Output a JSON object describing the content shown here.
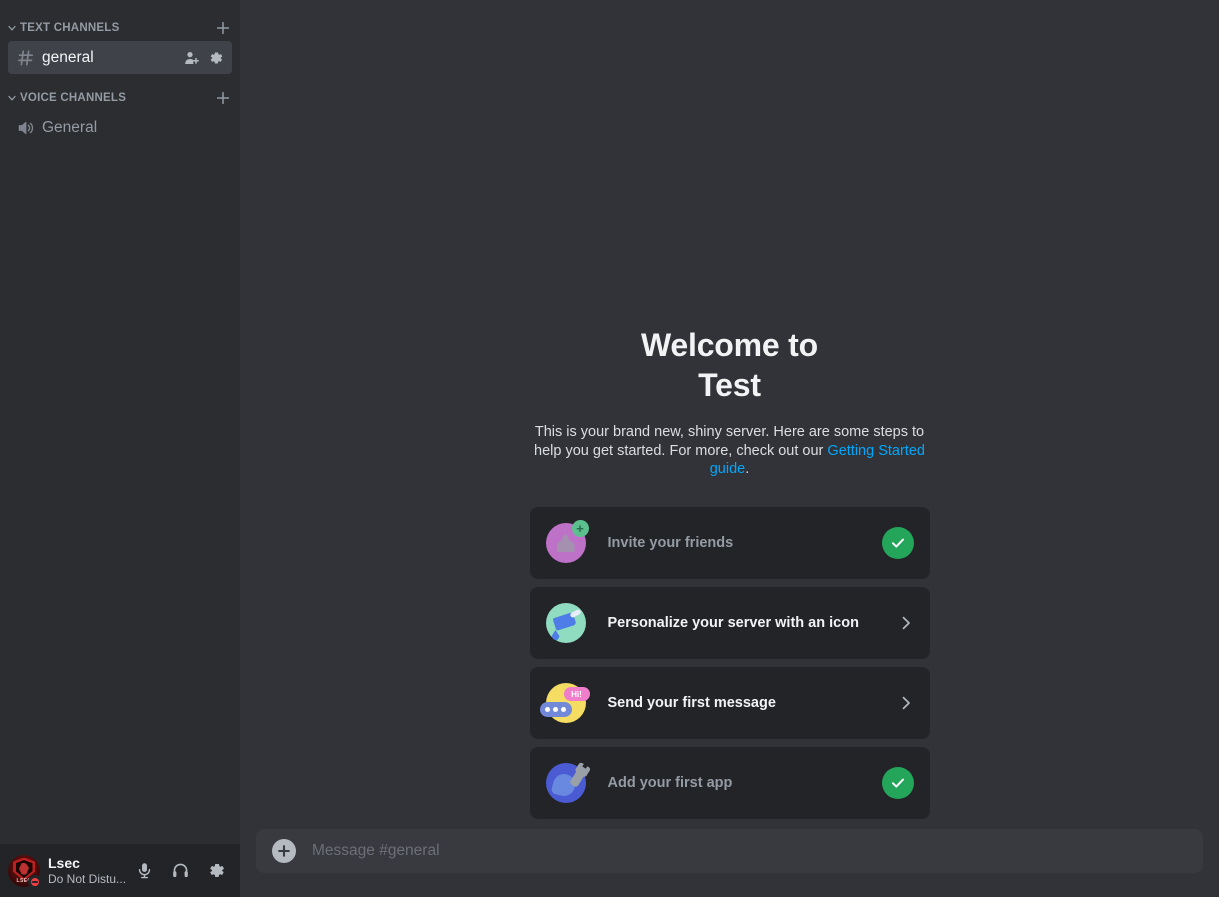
{
  "sidebar": {
    "categories": [
      {
        "label": "TEXT CHANNELS",
        "add_title": "Create Channel",
        "channels": [
          {
            "name": "general",
            "icon": "hash-icon",
            "active": true,
            "actions": [
              "invite-icon",
              "gear-icon"
            ]
          }
        ]
      },
      {
        "label": "VOICE CHANNELS",
        "add_title": "Create Channel",
        "channels": [
          {
            "name": "General",
            "icon": "speaker-icon",
            "active": false,
            "actions": []
          }
        ]
      }
    ],
    "user": {
      "name": "Lsec",
      "status": "Do Not Distu...",
      "avatar_text": "LSEC",
      "presence": "dnd",
      "buttons": [
        {
          "name": "mute-button",
          "icon": "microphone-icon"
        },
        {
          "name": "deafen-button",
          "icon": "headphones-icon"
        },
        {
          "name": "user-settings-button",
          "icon": "gear-icon"
        }
      ]
    }
  },
  "welcome": {
    "title_line1": "Welcome to",
    "title_line2": "Test",
    "description_before": "This is your brand new, shiny server. Here are some steps to help you get started. For more, check out our ",
    "link_text": "Getting Started guide",
    "description_after": ".",
    "cards": [
      {
        "label": "Invite your friends",
        "icon": "invite-friends-icon",
        "state": "done",
        "trailing": "check-icon"
      },
      {
        "label": "Personalize your server with an icon",
        "icon": "paintbrush-icon",
        "state": "todo",
        "trailing": "chevron-right-icon"
      },
      {
        "label": "Send your first message",
        "icon": "chat-bubbles-icon",
        "state": "todo",
        "trailing": "chevron-right-icon"
      },
      {
        "label": "Add your first app",
        "icon": "app-wrench-icon",
        "state": "done",
        "trailing": "check-icon"
      }
    ]
  },
  "composer": {
    "placeholder": "Message #general",
    "value": "",
    "attach_label": "+"
  },
  "colors": {
    "sidebar_bg": "#2b2d31",
    "main_bg": "#313338",
    "panel_bg": "#232428",
    "card_bg": "#232428",
    "accent_link": "#00a8fc",
    "success_green": "#23a55a",
    "dnd_red": "#f23f43",
    "text_primary": "#f2f3f5",
    "text_muted": "#949ba4"
  }
}
